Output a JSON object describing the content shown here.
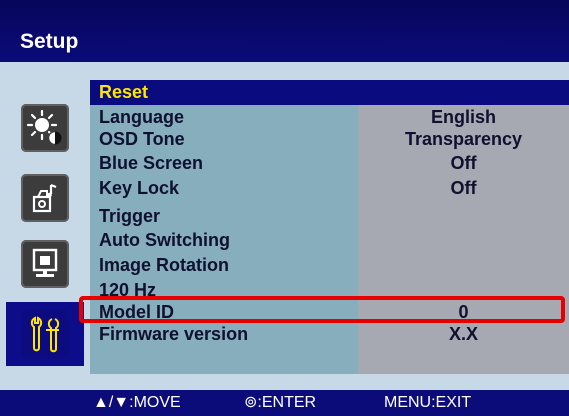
{
  "header": {
    "title": "Setup"
  },
  "sidebar": {
    "tabs": [
      {
        "icon": "brightness-contrast-icon",
        "active": false
      },
      {
        "icon": "audio-video-icon",
        "active": false
      },
      {
        "icon": "picture-in-picture-icon",
        "active": false
      },
      {
        "icon": "tools-icon",
        "active": true
      }
    ]
  },
  "menu": {
    "items": [
      {
        "label": "Reset",
        "value": ""
      },
      {
        "label": "Language",
        "value": "English"
      },
      {
        "label": "OSD Tone",
        "value": "Transparency"
      },
      {
        "label": "Blue Screen",
        "value": "Off"
      },
      {
        "label": "Key Lock",
        "value": "Off"
      },
      {
        "label": "Trigger",
        "value": ""
      },
      {
        "label": "Auto Switching",
        "value": ""
      },
      {
        "label": "Image Rotation",
        "value": ""
      },
      {
        "label": "120 Hz",
        "value": ""
      },
      {
        "label": "Model ID",
        "value": "0"
      },
      {
        "label": "Firmware version",
        "value": "X.X"
      }
    ],
    "selected": "Reset"
  },
  "footer": {
    "move": "▲/▼:MOVE",
    "enter": "⊚:ENTER",
    "exit": "MENU:EXIT"
  },
  "colors": {
    "header_bg": "#0b0b7a",
    "highlight_text": "#ffe600",
    "menu_bg": "#87aebd",
    "value_bg": "#a6a9b1",
    "annotation_box": "#e60000"
  }
}
